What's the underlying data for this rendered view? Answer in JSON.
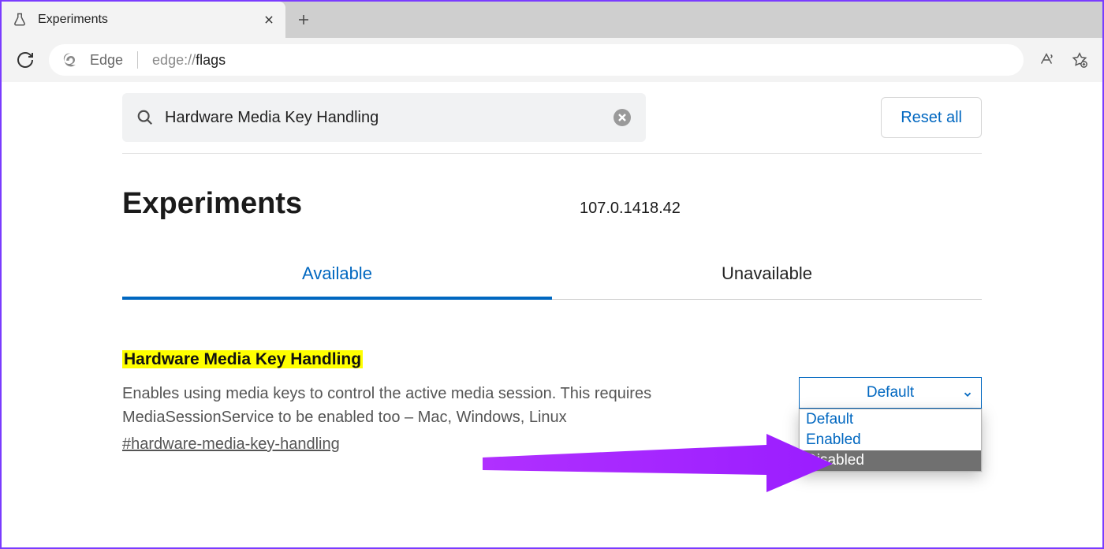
{
  "browser": {
    "tab_title": "Experiments",
    "omnibox_label": "Edge",
    "url_muted": "edge://",
    "url_strong": "flags"
  },
  "search": {
    "query": "Hardware Media Key Handling",
    "reset_label": "Reset all"
  },
  "header": {
    "title": "Experiments",
    "version": "107.0.1418.42"
  },
  "tabs": {
    "available": "Available",
    "unavailable": "Unavailable"
  },
  "flag": {
    "title": "Hardware Media Key Handling",
    "description": "Enables using media keys to control the active media session. This requires MediaSessionService to be enabled too – Mac, Windows, Linux",
    "anchor": "#hardware-media-key-handling",
    "selected": "Default",
    "options": [
      "Default",
      "Enabled",
      "Disabled"
    ],
    "hover_index": 2
  }
}
